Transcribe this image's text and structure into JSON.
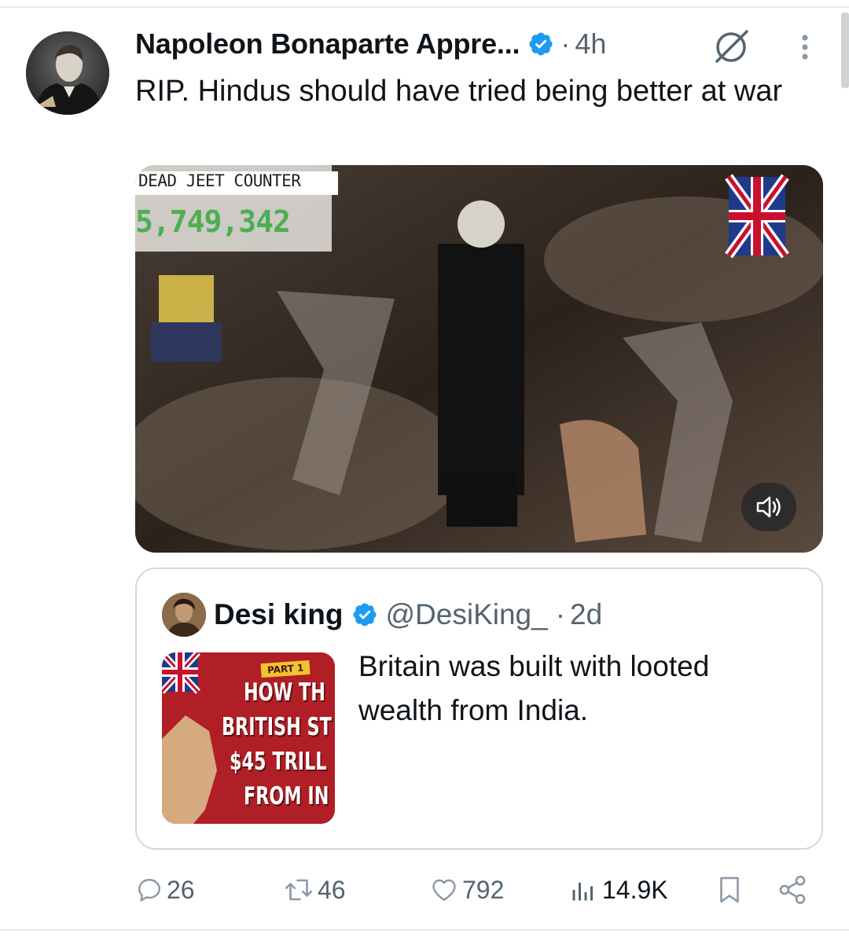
{
  "tweet": {
    "author_name": "Napoleon Bonaparte Appre...",
    "separator": "·",
    "time": "4h",
    "text": "RIP. Hindus should have tried being better at war",
    "media": {
      "overlay_title": "DEAD JEET COUNTER",
      "overlay_counter": "5,749,342"
    }
  },
  "quote": {
    "author_name": "Desi king",
    "handle": "@DesiKing_",
    "separator": "·",
    "time": "2d",
    "text": "Britain was built with looted wealth from India.",
    "thumbnail": {
      "badge": "PART 1",
      "lines": [
        "HOW TH",
        "BRITISH ST",
        "$45 TRILL",
        "FROM IN"
      ]
    }
  },
  "actions": {
    "replies": "26",
    "reposts": "46",
    "likes": "792",
    "views": "14.9K"
  },
  "colors": {
    "verified": "#1d9bf0",
    "secondary_text": "#536471",
    "border": "#cfd9de"
  },
  "icons": [
    "verified-badge-icon",
    "grok-icon",
    "more-icon",
    "volume-icon",
    "reply-icon",
    "repost-icon",
    "like-icon",
    "views-icon",
    "bookmark-icon",
    "share-icon"
  ]
}
